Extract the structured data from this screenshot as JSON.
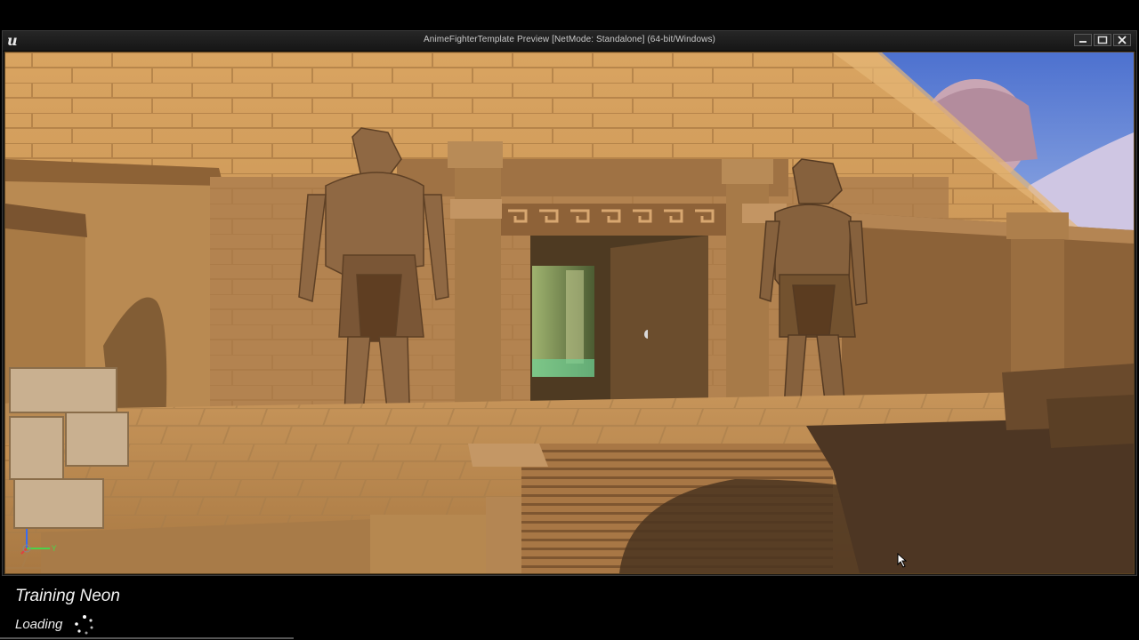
{
  "window": {
    "title": "AnimeFighterTemplate Preview [NetMode: Standalone]  (64-bit/Windows)",
    "logo_icon": "unreal-engine-logo-icon",
    "controls": [
      "minimize-icon",
      "maximize-icon",
      "close-icon"
    ]
  },
  "loading_screen": {
    "title": "Training Neon",
    "status": "Loading",
    "spinner_icon": "loading-spinner-icon"
  },
  "colors": {
    "window_chrome": "#1c1c1c",
    "title_text": "#c8c8c8",
    "sandstone": "#c89a5c",
    "sky": "#6f8fd8",
    "loading_bg": "#000000"
  }
}
